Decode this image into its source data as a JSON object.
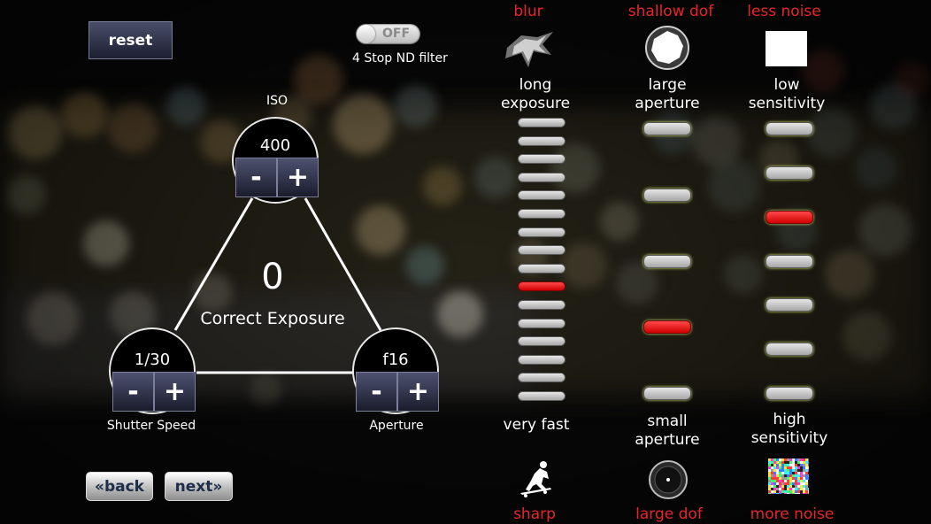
{
  "controls": {
    "reset_label": "reset",
    "nd_toggle": {
      "state": "OFF",
      "label": "4 Stop ND filter"
    }
  },
  "exposure_triangle": {
    "iso": {
      "title": "ISO",
      "value": "400"
    },
    "shutter": {
      "title": "Shutter Speed",
      "value": "1/30"
    },
    "aperture": {
      "title": "Aperture",
      "value": "f16"
    },
    "ev_value": "0",
    "ev_label": "Correct Exposure",
    "minus": "-",
    "plus": "+"
  },
  "navigation": {
    "back_label": "«back",
    "next_label": "next»"
  },
  "columns": {
    "shutter": {
      "top_effect": "blur",
      "top_label": "long exposure",
      "bottom_label": "very fast",
      "bottom_effect": "sharp",
      "top_icon": "motion-blur-icon",
      "bottom_icon": "skateboarder-icon",
      "levels": 16,
      "active_level": 10
    },
    "aperture": {
      "top_effect": "shallow dof",
      "top_label": "large aperture",
      "bottom_label": "small aperture",
      "bottom_effect": "large dof",
      "top_icon": "open-aperture-icon",
      "bottom_icon": "closed-aperture-icon",
      "levels": 5,
      "active_level": 4
    },
    "iso": {
      "top_effect": "less noise",
      "top_label": "low sensitivity",
      "bottom_label": "high sensitivity",
      "bottom_effect": "more noise",
      "top_icon": "clean-square-icon",
      "bottom_icon": "noise-square-icon",
      "levels": 7,
      "active_level": 3
    }
  },
  "colors": {
    "accent_red": "#e8252a",
    "button_navy": "#2a2d45",
    "pill_active": "#e00000",
    "pill_inactive": "#c8c8c8"
  }
}
